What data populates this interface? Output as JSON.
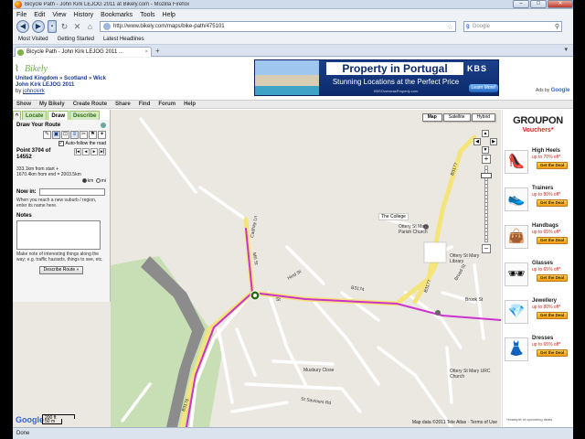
{
  "window": {
    "title": "Bicycle Path - John Kirk LEJOG 2011 at Bikely.com - Mozilla Firefox",
    "minimize": "–",
    "maximize": "□",
    "close": "✕"
  },
  "menubar": [
    "File",
    "Edit",
    "View",
    "History",
    "Bookmarks",
    "Tools",
    "Help"
  ],
  "navbar": {
    "back": "◀",
    "forward": "▶",
    "dropdown": "▾",
    "reload": "↻",
    "stop": "✕",
    "home": "⌂",
    "url": "http://www.bikely.com/maps/bike-path/475101",
    "search_brand": "g",
    "search_placeholder": "Google",
    "search_icon": "⚲"
  },
  "bookmarks": [
    "Most Visited",
    "Getting Started",
    "Latest Headlines"
  ],
  "tabs": [
    {
      "label": "Bicycle Path - John Kirk LEJOG 2011 ..."
    }
  ],
  "tab_new": "+",
  "tab_list": "▾",
  "site": {
    "logo": "Bikely",
    "breadcrumb": [
      "United Kingdom",
      "Scotland",
      "Wick"
    ],
    "breadcrumb_sep": " » ",
    "route_title": "John Kirk LEJOG 2011",
    "byline_prefix": "by ",
    "author": "johnckirk",
    "nav": [
      "Show",
      "My Bikely",
      "Create Route",
      "Share",
      "Find",
      "Forum",
      "Help"
    ]
  },
  "ad": {
    "headline": "Property in Portugal",
    "subline": "Stunning Locations at the Perfect Price",
    "url": "KBSOverseasProperty.com",
    "brand": "KBS",
    "cta": "Learn More!",
    "adsby_prefix": "Ads by",
    "adsby_brand": "Google"
  },
  "panel": {
    "toggle": "^",
    "tabs": [
      "Locate",
      "Draw",
      "Describe"
    ],
    "active_tab": "Draw",
    "heading": "Draw Your Route",
    "tools": [
      "✎",
      "▣",
      "⊡",
      "≡",
      "✂",
      "⚑",
      "✦"
    ],
    "autofollow_label": "Auto-follow the road",
    "autofollow_checked": "✓",
    "point_label": "Point 3704 of",
    "point_total": "14552",
    "arrows": [
      "|◂",
      "◂",
      "▸",
      "▸|"
    ],
    "dist_from_start": "333.1km from start +",
    "dist_from_end": "1670.4km from end = 2003.5km",
    "unit_km": "km",
    "unit_mi": "mi",
    "nowin_label": "Now in:",
    "nowin_hint": "When you reach a new suburb / region, enter its name here.",
    "notes_label": "Notes",
    "notes_hint": "Make note of interesting things along the way; e.g. traffic hazards, things to see, etc.",
    "describe_button": "Describe Route »"
  },
  "map": {
    "types": [
      "Map",
      "Satellite",
      "Hybrid"
    ],
    "active_type": "Map",
    "pan": {
      "up": "▲",
      "down": "▼",
      "left": "◀",
      "right": "▶"
    },
    "zoom_in": "+",
    "zoom_out": "–",
    "labels": {
      "college": "The College",
      "church1": "Ottery St Mary Parish Church",
      "church2": "Ottery St Mary URC Church",
      "library": "Ottery St Mary Library",
      "b3174": "B3174",
      "b3177": "B3177",
      "b3177b": "B3177",
      "hind": "Hind St",
      "mill": "Mill St",
      "cadhay": "Cadhay Ln",
      "musbury": "Musbury Close",
      "saviours": "St Saviours Rd",
      "broad": "Broad St",
      "b3176": "B3176",
      "st": "St",
      "brook": "Brook St"
    },
    "google": "Google",
    "scale_ft": "200 ft",
    "scale_m": "50 m",
    "copyright": "Map data ©2011 Tele Atlas · Terms of Use"
  },
  "groupon": {
    "logo": "GROUPON",
    "subtitle": "Vouchers*",
    "deals": [
      {
        "name": "High Heels",
        "off": "up to 70% off*",
        "icon": "👠"
      },
      {
        "name": "Trainers",
        "off": "up to 80% off*",
        "icon": "👟"
      },
      {
        "name": "Handbags",
        "off": "up to 65% off*",
        "icon": "👜"
      },
      {
        "name": "Glasses",
        "off": "up to 65% off*",
        "icon": "🕶"
      },
      {
        "name": "Jewellery",
        "off": "up to 80% off*",
        "icon": "💎"
      },
      {
        "name": "Dresses",
        "off": "up to 65% off*",
        "icon": "👗"
      }
    ],
    "cta": "Get the Deal",
    "footnote": "*example of upcoming deals"
  },
  "status": "Done",
  "colors": {
    "route": "#cc33cc",
    "road_major": "#f4e47a",
    "park": "#c8dfb6",
    "river": "#8c8c8c"
  }
}
